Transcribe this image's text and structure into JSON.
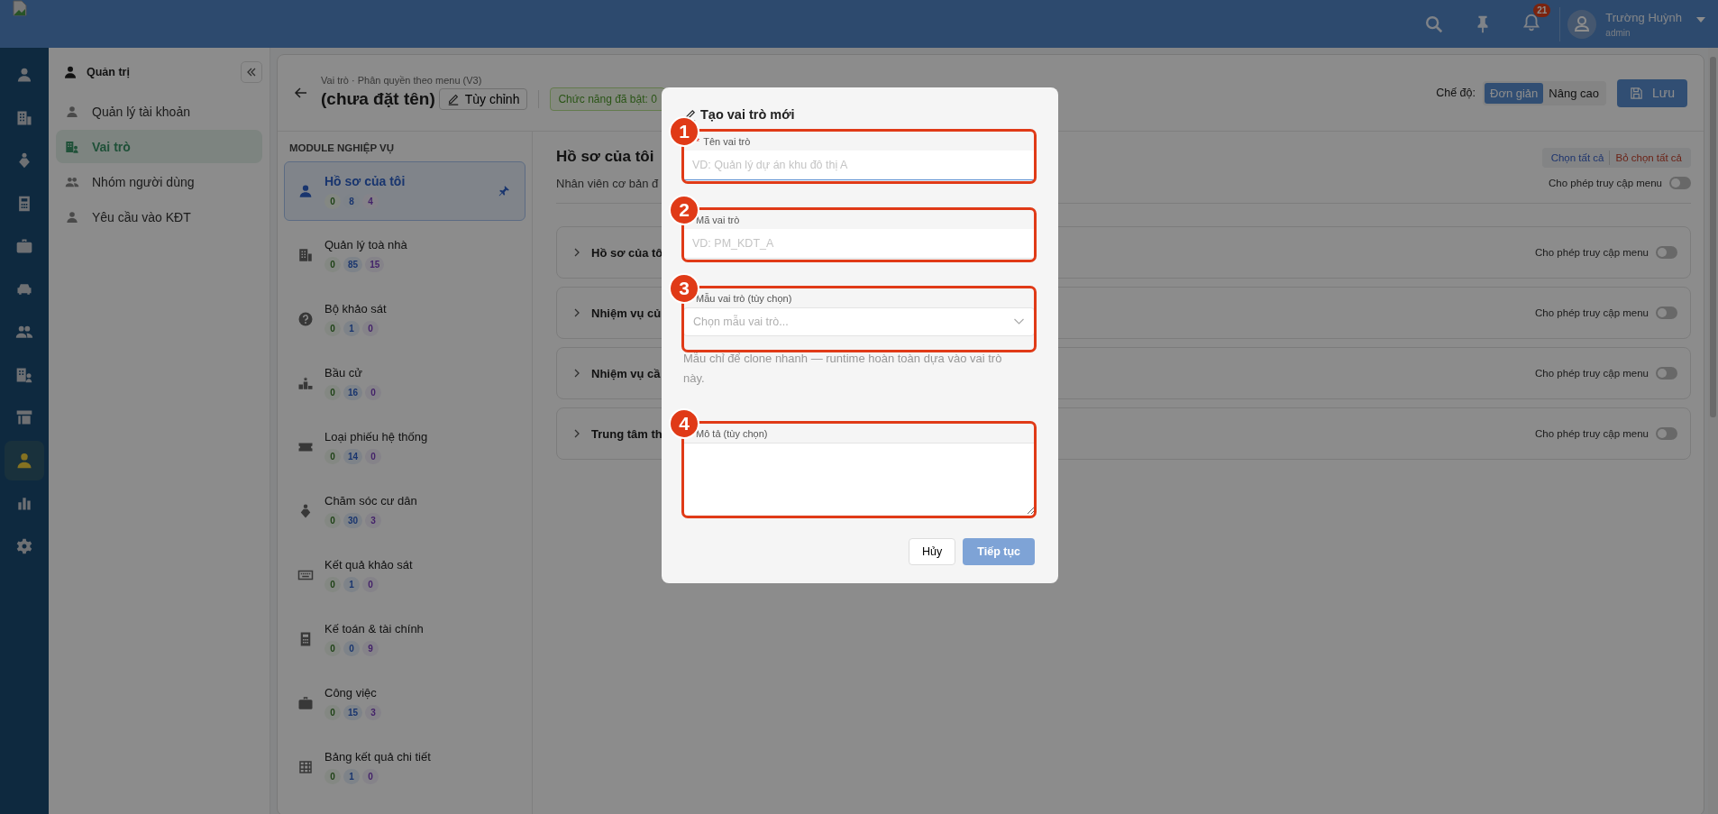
{
  "topbar": {
    "notification_count": "21",
    "user": {
      "name": "Trường Huỳnh",
      "role": "admin"
    }
  },
  "rail": [
    {
      "selected": false
    },
    {
      "selected": false
    },
    {
      "selected": false
    },
    {
      "selected": false
    },
    {
      "selected": false
    },
    {
      "selected": false
    },
    {
      "selected": false
    },
    {
      "selected": false
    },
    {
      "selected": false
    },
    {
      "selected": true
    },
    {
      "selected": false
    },
    {
      "selected": false
    }
  ],
  "sidebar": {
    "title": "Quản trị",
    "items": [
      {
        "label": "Quản lý tài khoản",
        "selected": false
      },
      {
        "label": "Vai trò",
        "selected": true
      },
      {
        "label": "Nhóm người dùng",
        "selected": false
      },
      {
        "label": "Yêu cầu vào KĐT",
        "selected": false
      }
    ]
  },
  "header": {
    "breadcrumb": "Vai trò · Phân quyền theo menu (V3)",
    "title": "(chưa đặt tên)",
    "edit_button": "Tùy chỉnh",
    "badge": "Chức năng đã bật: 0",
    "mode_label": "Chế độ:",
    "modes": [
      {
        "label": "Đơn giản",
        "selected": true
      },
      {
        "label": "Nâng cao",
        "selected": false
      }
    ],
    "save_button": "Lưu"
  },
  "modules": {
    "heading": "MODULE NGHIỆP VỤ",
    "items": [
      {
        "name": "Hồ sơ của tôi",
        "selected": true,
        "pinned": true,
        "counts": [
          "0",
          "8",
          "4"
        ]
      },
      {
        "name": "Quản lý toà nhà",
        "selected": false,
        "pinned": false,
        "counts": [
          "0",
          "85",
          "15"
        ]
      },
      {
        "name": "Bộ khảo sát",
        "selected": false,
        "pinned": false,
        "counts": [
          "0",
          "1",
          "0"
        ]
      },
      {
        "name": "Bầu cử",
        "selected": false,
        "pinned": false,
        "counts": [
          "0",
          "16",
          "0"
        ]
      },
      {
        "name": "Loại phiếu hệ thống",
        "selected": false,
        "pinned": false,
        "counts": [
          "0",
          "14",
          "0"
        ]
      },
      {
        "name": "Chăm sóc cư dân",
        "selected": false,
        "pinned": false,
        "counts": [
          "0",
          "30",
          "3"
        ]
      },
      {
        "name": "Kết quả khảo sát",
        "selected": false,
        "pinned": false,
        "counts": [
          "0",
          "1",
          "0"
        ]
      },
      {
        "name": "Kế toán & tài chính",
        "selected": false,
        "pinned": false,
        "counts": [
          "0",
          "0",
          "9"
        ]
      },
      {
        "name": "Công việc",
        "selected": false,
        "pinned": false,
        "counts": [
          "0",
          "15",
          "3"
        ]
      },
      {
        "name": "Bảng kết quả chi tiết",
        "selected": false,
        "pinned": false,
        "counts": [
          "0",
          "1",
          "0"
        ]
      }
    ]
  },
  "detail": {
    "title": "Hồ sơ của tôi",
    "subtitle": "Nhân viên cơ bản đ",
    "select_all": "Chọn tất cả",
    "deselect_all": "Bỏ chọn tất cả",
    "toggle_label": "Cho phép truy cập menu",
    "toggle_on": false,
    "sections": [
      {
        "title": "Hồ sơ của tô",
        "toggle_label": "Cho phép truy cập menu",
        "on": false
      },
      {
        "title": "Nhiệm vụ củ",
        "toggle_label": "Cho phép truy cập menu",
        "on": false
      },
      {
        "title": "Nhiệm vụ cầ",
        "toggle_label": "Cho phép truy cập menu",
        "on": false
      },
      {
        "title": "Trung tâm th",
        "toggle_label": "Cho phép truy cập menu",
        "on": false
      }
    ]
  },
  "modal": {
    "title": "Tạo vai trò mới",
    "fields": [
      {
        "kind": "input",
        "label": "Tên vai trò",
        "required_mark": "*",
        "placeholder": "VD: Quản lý dự án khu đô thị A",
        "focused": true,
        "annotation": "1"
      },
      {
        "kind": "input",
        "label": "Mã vai trò",
        "placeholder": "VD: PM_KDT_A",
        "focused": false,
        "annotation": "2"
      },
      {
        "kind": "select",
        "label": "Mẫu vai trò (tùy chọn)",
        "placeholder": "Chọn mẫu vai trò...",
        "help": "Mẫu chỉ để clone nhanh — runtime hoàn toàn dựa vào vai trò này.",
        "focused": false,
        "annotation": "3"
      },
      {
        "kind": "textarea",
        "label": "Mô tả (tùy chọn)",
        "focused": false,
        "annotation": "4"
      }
    ],
    "cancel": "Hủy",
    "submit": {
      "label": "Tiếp tục",
      "disabled": true
    }
  }
}
